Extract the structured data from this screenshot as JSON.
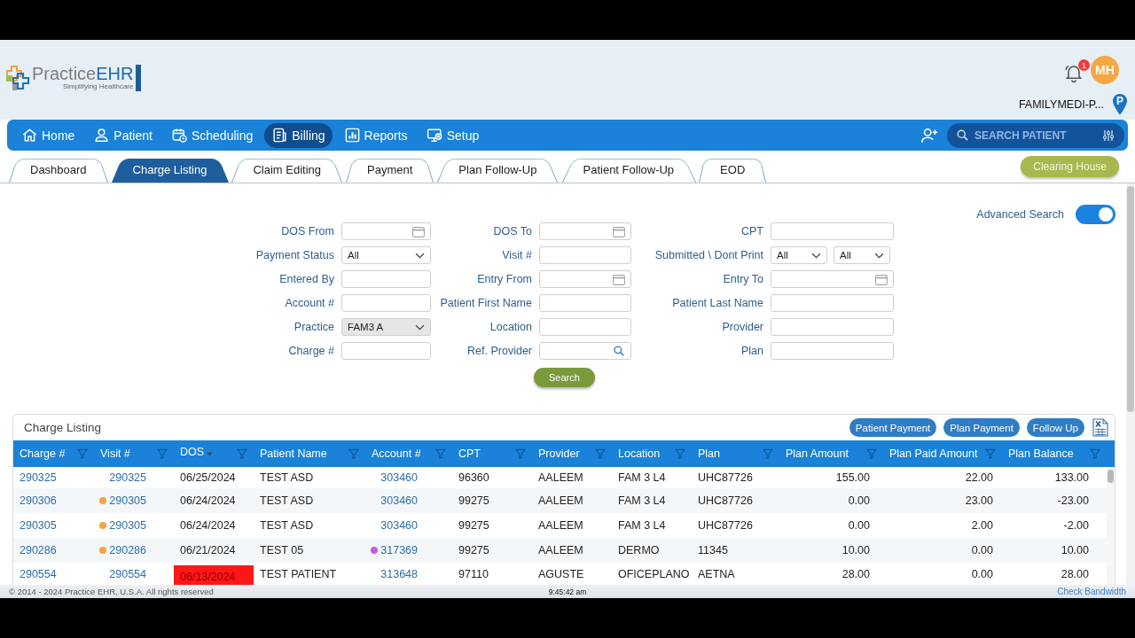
{
  "logo": {
    "text_1": "Practice",
    "text_2": "EHR",
    "tagline": "Simplifying Healthcare"
  },
  "header": {
    "notification_count": "1",
    "user_initials": "MH",
    "practice_name": "FAMILYMEDI-P...",
    "practice_pin": "P"
  },
  "nav": {
    "items": [
      {
        "label": "Home",
        "selected": false
      },
      {
        "label": "Patient",
        "selected": false
      },
      {
        "label": "Scheduling",
        "selected": false
      },
      {
        "label": "Billing",
        "selected": true
      },
      {
        "label": "Reports",
        "selected": false
      },
      {
        "label": "Setup",
        "selected": false
      }
    ],
    "search": {
      "placeholder": "SEARCH PATIENT"
    }
  },
  "tabs": [
    {
      "label": "Dashboard",
      "selected": false
    },
    {
      "label": "Charge Listing",
      "selected": true
    },
    {
      "label": "Claim Editing",
      "selected": false
    },
    {
      "label": "Payment",
      "selected": false
    },
    {
      "label": "Plan Follow-Up",
      "selected": false
    },
    {
      "label": "Patient Follow-Up",
      "selected": false
    },
    {
      "label": "EOD",
      "selected": false
    }
  ],
  "clearing_house_button": "Clearing House",
  "advanced_search": {
    "label": "Advanced Search",
    "on": true
  },
  "filters": [
    {
      "label": "DOS From",
      "kind": "date",
      "disabled": false
    },
    {
      "label": "DOS To",
      "kind": "date",
      "disabled": false
    },
    {
      "label": "CPT",
      "kind": "text",
      "disabled": false
    },
    {
      "label": "Payment Status",
      "kind": "select",
      "value": "All",
      "disabled": false
    },
    {
      "label": "Visit #",
      "kind": "text",
      "disabled": false
    },
    {
      "label": "Submitted \\ Dont Print",
      "kind": "select_pair",
      "values": [
        "All",
        "All"
      ],
      "disabled": false
    },
    {
      "label": "Entered By",
      "kind": "text",
      "disabled": false
    },
    {
      "label": "Entry From",
      "kind": "date",
      "disabled": false
    },
    {
      "label": "Entry To",
      "kind": "date",
      "disabled": false
    },
    {
      "label": "Account #",
      "kind": "text",
      "disabled": false
    },
    {
      "label": "Patient First Name",
      "kind": "text",
      "disabled": false
    },
    {
      "label": "Patient Last Name",
      "kind": "text",
      "disabled": false
    },
    {
      "label": "Practice",
      "kind": "select",
      "value": "FAM3 A",
      "disabled": true
    },
    {
      "label": "Location",
      "kind": "text",
      "disabled": false
    },
    {
      "label": "Provider",
      "kind": "text",
      "disabled": false
    },
    {
      "label": "Charge #",
      "kind": "text",
      "disabled": false
    },
    {
      "label": "Ref. Provider",
      "kind": "lookup",
      "disabled": false
    },
    {
      "label": "Plan",
      "kind": "text",
      "disabled": false
    }
  ],
  "search_button": "Search",
  "charge_listing": {
    "title": "Charge Listing",
    "buttons": [
      "Patient Payment",
      "Plan Payment",
      "Follow Up"
    ],
    "columns": [
      {
        "label": "Charge #",
        "sorted": false
      },
      {
        "label": "Visit #",
        "sorted": false
      },
      {
        "label": "DOS",
        "sorted": true
      },
      {
        "label": "Patient Name",
        "sorted": false
      },
      {
        "label": "Account #",
        "sorted": false
      },
      {
        "label": "CPT",
        "sorted": false
      },
      {
        "label": "Provider",
        "sorted": false
      },
      {
        "label": "Location",
        "sorted": false
      },
      {
        "label": "Plan",
        "sorted": false
      },
      {
        "label": "Plan Amount",
        "sorted": false
      },
      {
        "label": "Plan Paid Amount",
        "sorted": false
      },
      {
        "label": "Plan Balance",
        "sorted": false
      }
    ],
    "rows": [
      {
        "cells": [
          "290325",
          "290325",
          "06/25/2024",
          "TEST ASD",
          "303460",
          "96360",
          "AALEEM",
          "FAM 3 L4",
          "UHC87726",
          "155.00",
          "22.00",
          "133.00"
        ],
        "dos_flagged": false
      },
      {
        "cells": [
          "290306",
          "290305",
          "06/24/2024",
          "TEST ASD",
          "303460",
          "99275",
          "AALEEM",
          "FAM 3 L4",
          "UHC87726",
          "0.00",
          "23.00",
          "-23.00"
        ],
        "dos_flagged": false,
        "visit_marker": {
          "color": "#f5a33b"
        }
      },
      {
        "cells": [
          "290305",
          "290305",
          "06/24/2024",
          "TEST ASD",
          "303460",
          "99275",
          "AALEEM",
          "FAM 3 L4",
          "UHC87726",
          "0.00",
          "2.00",
          "-2.00"
        ],
        "dos_flagged": false,
        "visit_marker": {
          "color": "#f5a33b"
        }
      },
      {
        "cells": [
          "290286",
          "290286",
          "06/21/2024",
          "TEST 05",
          "317369",
          "99275",
          "AALEEM",
          "DERMO",
          "11345",
          "10.00",
          "0.00",
          "10.00"
        ],
        "dos_flagged": false,
        "visit_marker": {
          "color": "#f5a33b"
        },
        "account_marker": {
          "color": "#c65be0"
        }
      },
      {
        "cells": [
          "290554",
          "290554",
          "06/13/2024",
          "TEST PATIENT",
          "313648",
          "97110",
          "AGUSTE",
          "OFICEPLANO",
          "AETNA",
          "28.00",
          "0.00",
          "28.00"
        ],
        "dos_flagged": true
      }
    ]
  },
  "footer": {
    "copyright": "© 2014 - 2024 Practice EHR, U.S.A. All rights reserved",
    "time": "9:45:42 am",
    "link": "Check Bandwidth"
  }
}
